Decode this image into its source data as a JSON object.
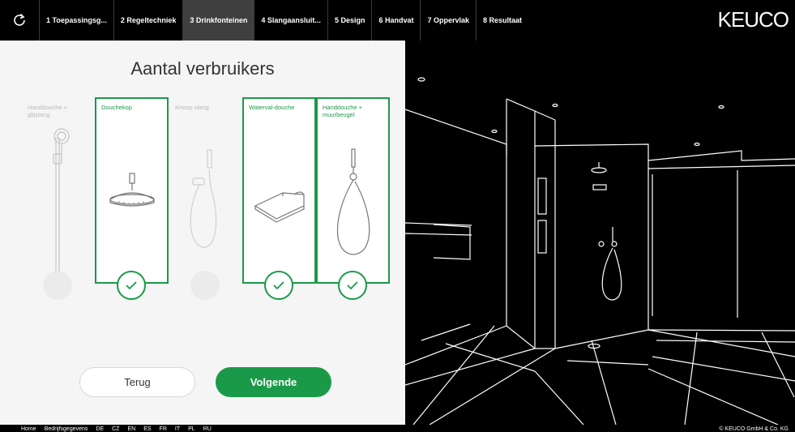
{
  "nav": {
    "steps": [
      {
        "label": "1 Toepassingsg..."
      },
      {
        "label": "2 Regeltechniek"
      },
      {
        "label": "3 Drinkfonteinen"
      },
      {
        "label": "4 Slangaansluit..."
      },
      {
        "label": "5 Design"
      },
      {
        "label": "6 Handvat"
      },
      {
        "label": "7 Oppervlak"
      },
      {
        "label": "8 Resultaat"
      }
    ],
    "active_step": 3,
    "logo": "KEUCO"
  },
  "main": {
    "title": "Aantal verbruikers",
    "options": [
      {
        "label": "Handdouche + glijstang",
        "selected": false
      },
      {
        "label": "Douchekop",
        "selected": true
      },
      {
        "label": "Knoop slang",
        "selected": false
      },
      {
        "label": "Waterval-douche",
        "selected": true
      },
      {
        "label": "Handdouche + muurbeugel",
        "selected": true
      }
    ],
    "back_label": "Terug",
    "next_label": "Volgende"
  },
  "footer": {
    "links": [
      "Home",
      "Bedrijfsgegevens",
      "DE",
      "CZ",
      "EN",
      "ES",
      "FR",
      "IT",
      "PL",
      "RU"
    ],
    "copyright": "© KEUCO GmbH & Co. KG"
  },
  "colors": {
    "accent": "#1a9a48",
    "panel": "#f5f5f5",
    "nav": "#000000"
  },
  "icons": {
    "reload": "reload-icon",
    "check": "checkmark-icon"
  }
}
